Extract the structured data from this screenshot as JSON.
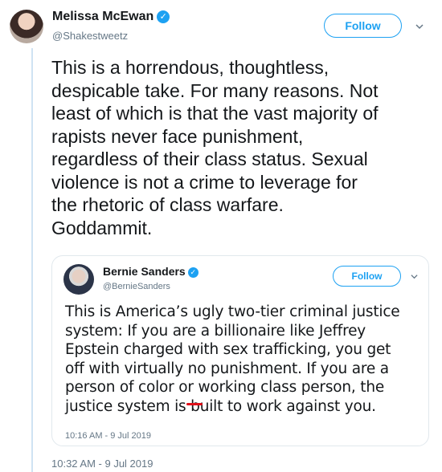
{
  "author": {
    "name": "Melissa McEwan",
    "handle": "@Shakestweetz",
    "verified_icon": "verified-badge-icon",
    "follow_label": "Follow"
  },
  "tweet": {
    "text": "This is a horrendous, thoughtless,\ndespicable take. For many reasons. Not\nleast of which is that the vast majority of\nrapists never face punishment,\nregardless of their class status. Sexual\nviolence is not a crime to leverage for\nthe rhetoric of class warfare.\nGoddammit.",
    "timestamp": "10:32 AM - 9 Jul 2019"
  },
  "quoted": {
    "name": "Bernie Sanders",
    "handle": "@BernieSanders",
    "follow_label": "Follow",
    "text": "This is America’s ugly two-tier criminal justice\nsystem: If you are a billionaire like Jeffrey\nEpstein charged with sex trafficking, you get\noff with virtually no punishment. If you are a\nperson of color or working class person, the\njustice system is built to work against you.",
    "timestamp": "10:16 AM - 9 Jul 2019"
  },
  "colors": {
    "accent": "#1da1f2",
    "secondary_text": "#657786",
    "annotation_mark": "#e0101a"
  }
}
